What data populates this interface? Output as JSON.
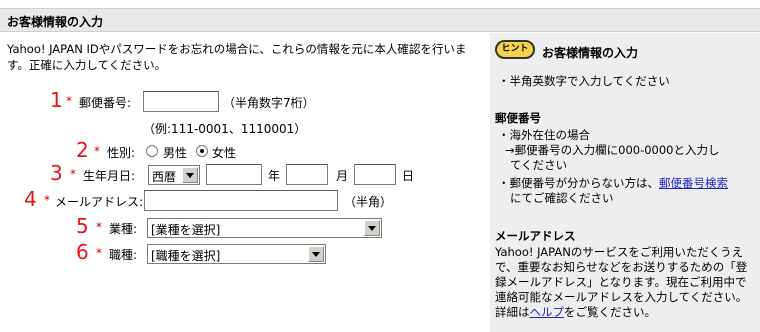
{
  "header": {
    "title": "お客様情報の入力"
  },
  "intro": {
    "line1": "Yahoo! JAPAN IDやパスワードをお忘れの場合に、これらの情報を元に本人確認を行いま",
    "line2": "す。正確に入力してください。"
  },
  "form": {
    "required_mark": "*",
    "postal": {
      "number": "1",
      "label": "郵便番号:",
      "value": "",
      "note": "（半角数字7桁）",
      "example": "（例:111-0001、1110001）"
    },
    "gender": {
      "number": "2",
      "label": "性別:",
      "options": [
        "男性",
        "女性"
      ],
      "selected": "女性"
    },
    "birthday": {
      "number": "3",
      "label": "生年月日:",
      "era": "西暦",
      "year_unit": "年",
      "month_unit": "月",
      "day_unit": "日",
      "year": "",
      "month": "",
      "day": ""
    },
    "email": {
      "number": "4",
      "label": "メールアドレス:",
      "value": "",
      "note": "（半角）"
    },
    "industry": {
      "number": "5",
      "label": "業種:",
      "selected": "[業種を選択]"
    },
    "occupation": {
      "number": "6",
      "label": "職種:",
      "selected": "[職種を選択]"
    }
  },
  "sidebar": {
    "hint_badge": "ヒント",
    "title": "お客様情報の入力",
    "bullet1": "・半角英数字で入力してください",
    "postal_heading": "郵便番号",
    "postal_b1": "・海外在住の場合",
    "postal_b1_l2": "→郵便番号の入力欄に000-0000と入力し",
    "postal_b1_l3": "てください",
    "postal_b2_pre": "・郵便番号が分からない方は、",
    "postal_b2_link": "郵便番号検索",
    "postal_b2_l2": "にてご確認ください",
    "email_heading": "メールアドレス",
    "email_l1": "Yahoo! JAPANのサービスをご利用いただくうえ",
    "email_l2": "で、重要なお知らせなどをお送りするための「登",
    "email_l3": "録メールアドレス」となります。現在ご利用中で",
    "email_l4": "連絡可能なメールアドレスを入力してください。",
    "email_l5_pre": "詳細は",
    "email_l5_link": "ヘルプ",
    "email_l5_post": "をご覧ください。"
  }
}
